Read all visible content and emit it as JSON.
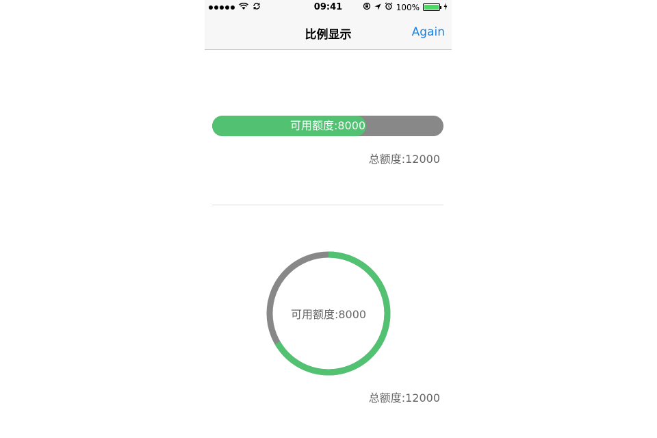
{
  "status_bar": {
    "time": "09:41",
    "battery": "100%",
    "icons": [
      "signal-dots-icon",
      "wifi-icon",
      "sync-icon",
      "rotation-lock-icon",
      "location-icon",
      "alarm-icon",
      "battery-icon",
      "charging-icon"
    ]
  },
  "nav": {
    "title": "比例显示",
    "again_label": "Again"
  },
  "bar": {
    "label": "可用额度:8000",
    "total_label": "总额度:12000",
    "available": 8000,
    "total": 12000,
    "fill_color": "#52c172",
    "track_color": "#888888"
  },
  "ring": {
    "label": "可用额度:8000",
    "total_label": "总额度:12000",
    "available": 8000,
    "total": 12000,
    "fill_color": "#52c172",
    "track_color": "#888888"
  },
  "colors": {
    "accent": "#1a82e2",
    "text_secondary": "#666666"
  }
}
